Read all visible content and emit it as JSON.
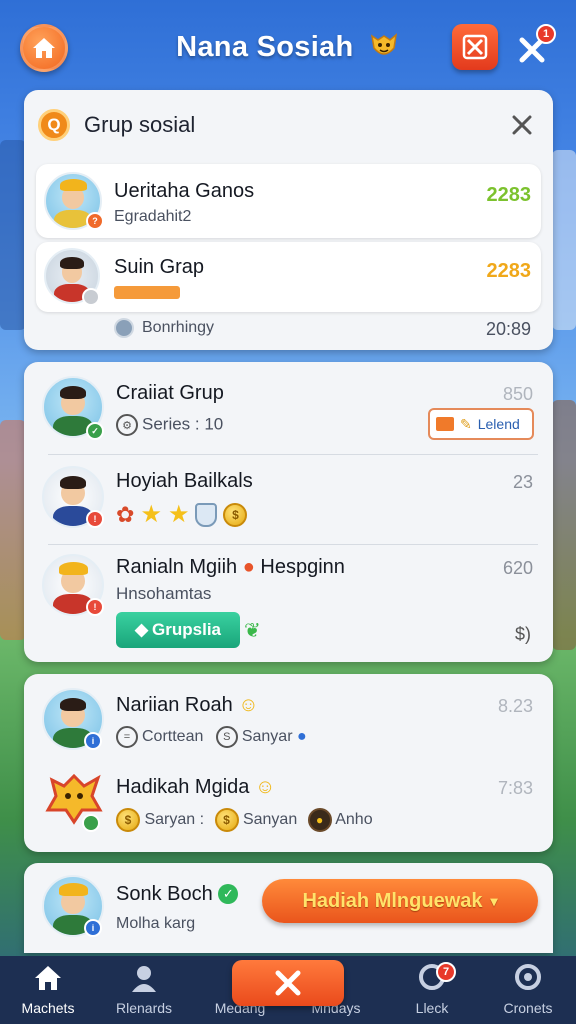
{
  "header": {
    "title": "Nana Sosiah",
    "game_badge_count": "",
    "tools_badge_count": "1"
  },
  "group_panel": {
    "title": "Grup sosial",
    "badge_letter": "Q",
    "items": [
      {
        "name": "Ueritaha Ganos",
        "sub": "Egradahit2",
        "value": "2283",
        "value_color": "#7cc22e"
      },
      {
        "name": "Suin Grap",
        "sub": "",
        "value": "2283",
        "value_color": "#f0a81a"
      }
    ],
    "footer": {
      "label": "Bonrhingy",
      "value": "20:89"
    }
  },
  "panel2": {
    "items": [
      {
        "name": "Craiiat Grup",
        "sub": "Series : 10",
        "value": "850",
        "tag": "Lelend"
      },
      {
        "name": "Hoyiah Bailkals",
        "value": "23"
      },
      {
        "name": "Ranialn Mgiih",
        "name_suffix": "Hespginn",
        "sub": "Hnsohamtas",
        "value": "620",
        "extra_value": "$)",
        "chip": "Grupslia"
      }
    ]
  },
  "panel3": {
    "items": [
      {
        "name": "Nariian Roah",
        "value": "8.23",
        "chips": [
          "Corttean",
          "Sanyar"
        ]
      },
      {
        "name": "Hadikah Mgida",
        "value": "7:83",
        "chips": [
          "Saryan :",
          "Sanyan",
          "Anho"
        ]
      }
    ]
  },
  "panel4": {
    "name": "Sonk Boch",
    "sub": "Molha karg",
    "button": "Hadiah Mlnguewak"
  },
  "nav": [
    {
      "label": "Machets"
    },
    {
      "label": "Rlenards"
    },
    {
      "label": "Medang"
    },
    {
      "label": "Mhdays"
    },
    {
      "label": "Lleck",
      "badge": "7"
    },
    {
      "label": "Cronets"
    }
  ]
}
